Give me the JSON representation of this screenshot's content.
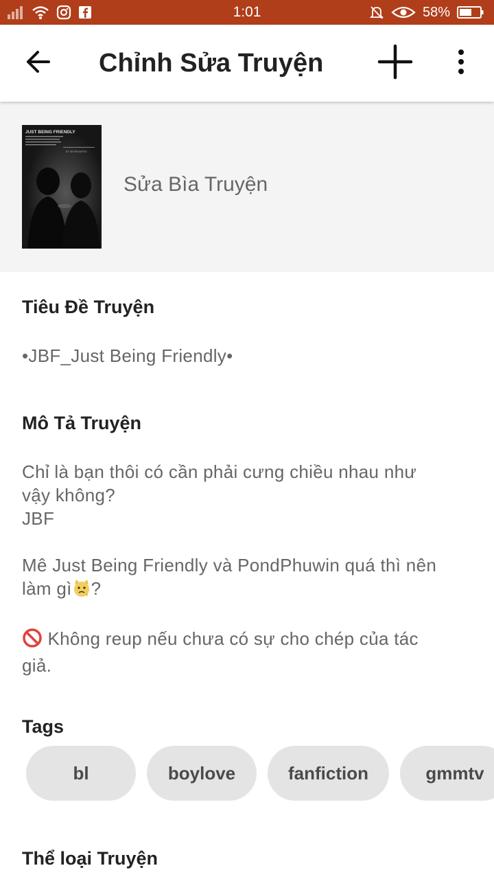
{
  "status_bar": {
    "time": "1:01",
    "battery_percent": "58%",
    "background_color": "#b03e1a",
    "left_icons": [
      "signal-icon",
      "wifi-icon",
      "instagram-icon",
      "facebook-icon"
    ],
    "right_icons": [
      "muted-bell-icon",
      "eye-icon",
      "battery-icon"
    ]
  },
  "app_bar": {
    "title": "Chỉnh Sửa Truyện",
    "back_icon": "back-arrow-icon",
    "add_icon": "plus-icon",
    "more_icon": "more-vertical-icon"
  },
  "cover": {
    "label": "Sửa Bìa Truyện",
    "thumbnail_title": "JUST BEING FRIENDLY",
    "thumbnail_byline": "BY SEVENUNITED"
  },
  "title_section": {
    "heading": "Tiêu Đề Truyện",
    "value": "•JBF_Just Being Friendly•"
  },
  "description_section": {
    "heading": "Mô Tả Truyện",
    "lines": [
      "Chỉ là bạn thôi có cần phải cưng chiều nhau như",
      "vậy không?",
      "JBF",
      "",
      "Mê Just Being Friendly và PondPhuwin quá thì nên",
      "làm gì",
      "?",
      "",
      "Không reup nếu chưa có sự cho chép của tác",
      "giả."
    ],
    "emoji_icons": [
      "thinking-cat-emoji-icon",
      "no-entry-icon"
    ]
  },
  "tags_section": {
    "heading": "Tags",
    "tags": [
      "bl",
      "boylove",
      "fanfiction",
      "gmmtv"
    ]
  },
  "genre_section": {
    "heading": "Thể loại Truyện"
  }
}
